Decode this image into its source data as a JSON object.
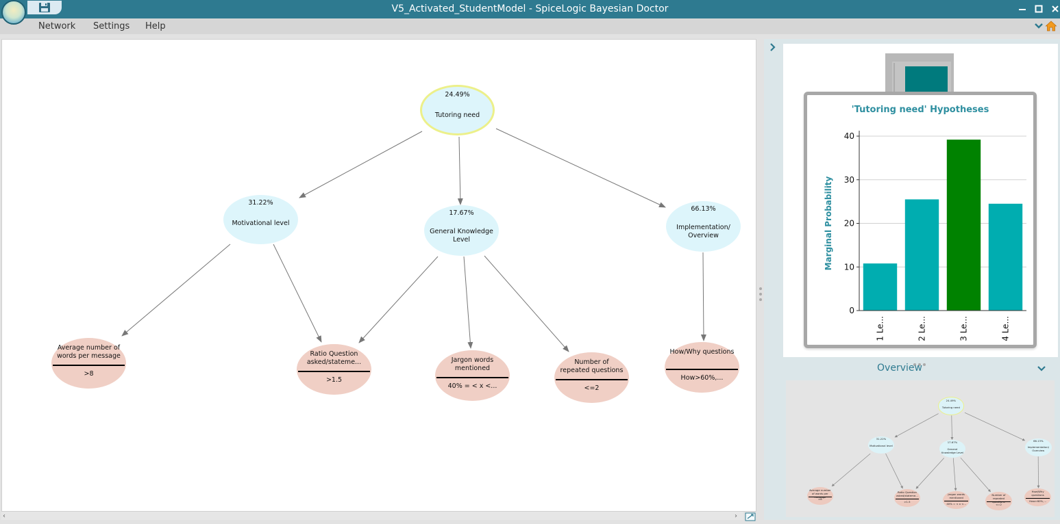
{
  "window": {
    "title": "V5_Activated_StudentModel - SpiceLogic Bayesian Doctor"
  },
  "menu": [
    {
      "label": "Network"
    },
    {
      "label": "Settings"
    },
    {
      "label": "Help"
    }
  ],
  "network": {
    "nodes": [
      {
        "id": "tutoring",
        "kind": "root",
        "pct": "24.49%",
        "label": "Tutoring need"
      },
      {
        "id": "motivation",
        "kind": "hyp",
        "pct": "31.22%",
        "label": "Motivational level"
      },
      {
        "id": "knowledge",
        "kind": "hyp",
        "pct": "17.67%",
        "label": "General Knowledge Level"
      },
      {
        "id": "implementation",
        "kind": "hyp",
        "pct": "66.13%",
        "label": "Implementation/ Overview"
      },
      {
        "id": "avgwords",
        "kind": "evi",
        "label": "Average number of words per message",
        "state": ">8"
      },
      {
        "id": "ratio",
        "kind": "evi",
        "label": "Ratio Question asked/stateme...",
        "state": ">1.5"
      },
      {
        "id": "jargon",
        "kind": "evi",
        "label": "Jargon words mentioned",
        "state": "40% = < x <..."
      },
      {
        "id": "repeated",
        "kind": "evi",
        "label": "Number of repeated questions",
        "state": "<=2"
      },
      {
        "id": "howwhy",
        "kind": "evi",
        "label": "How/Why questions",
        "state": "How>60%,..."
      }
    ],
    "edges": [
      [
        "tutoring",
        "motivation"
      ],
      [
        "tutoring",
        "knowledge"
      ],
      [
        "tutoring",
        "implementation"
      ],
      [
        "motivation",
        "avgwords"
      ],
      [
        "motivation",
        "ratio"
      ],
      [
        "knowledge",
        "ratio"
      ],
      [
        "knowledge",
        "jargon"
      ],
      [
        "knowledge",
        "repeated"
      ],
      [
        "implementation",
        "howwhy"
      ]
    ]
  },
  "chart_data": {
    "type": "bar",
    "title": "'Tutoring need' Hypotheses",
    "ylabel": "Marginal Probability",
    "categories": [
      "1 Le...",
      "2 Le...",
      "3 Le...",
      "4 Le..."
    ],
    "values": [
      10.8,
      25.5,
      39.2,
      24.5
    ],
    "highlight_index": 2,
    "ylim": [
      0,
      40
    ],
    "yticks": [
      0,
      10,
      20,
      30,
      40
    ],
    "grid": true,
    "colors": {
      "bar": "#00adb0",
      "highlight": "#008200",
      "title": "#2e8fa0"
    }
  },
  "overview": {
    "title": "Overview"
  },
  "colors": {
    "titlebar": "#2e7a90",
    "hypothesis_node": "#ddf5fb",
    "evidence_node": "#f0cfc5",
    "root_border": "#ecf08a",
    "edge": "#777777"
  },
  "icons": {
    "save": "floppy-disk-icon",
    "home": "home-icon",
    "minimize": "minimize-icon",
    "maximize": "maximize-icon",
    "close": "close-icon",
    "fit": "zoom-fit-icon"
  }
}
